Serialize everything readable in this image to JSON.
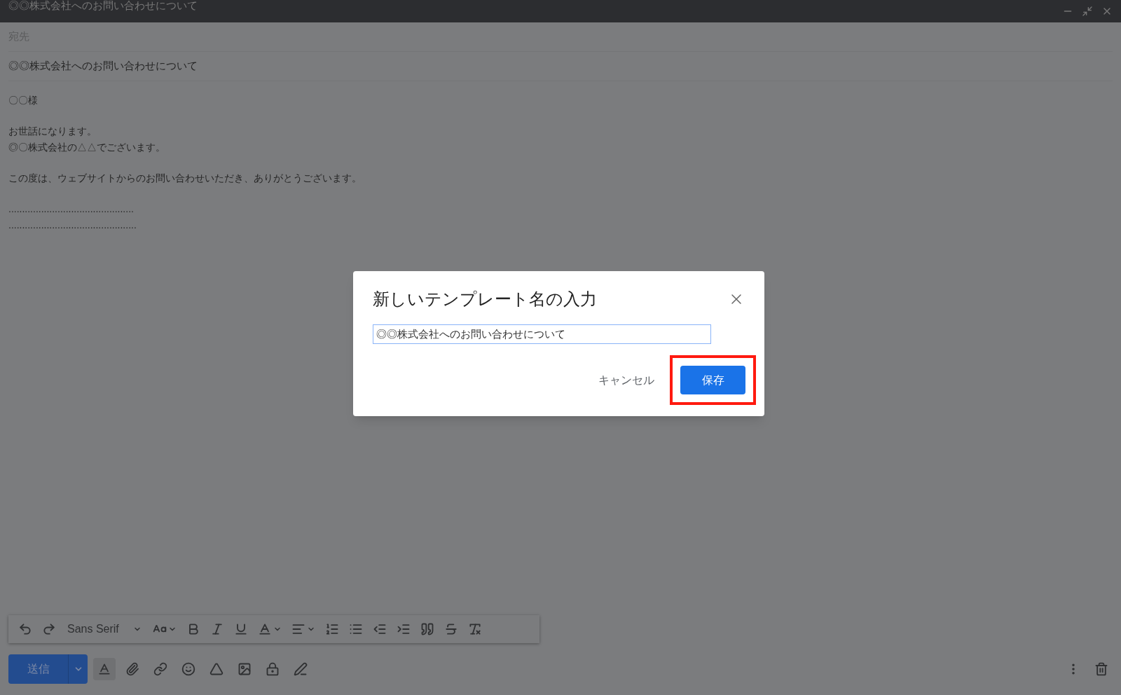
{
  "window": {
    "title": "◎◎株式会社へのお問い合わせについて"
  },
  "compose": {
    "to_placeholder": "宛先",
    "subject": "◎◎株式会社へのお問い合わせについて",
    "body": [
      {
        "lines": [
          "〇〇様"
        ]
      },
      {
        "lines": [
          "お世話になります。",
          "◎〇株式会社の△△でございます。"
        ]
      },
      {
        "lines": [
          "この度は、ウェブサイトからのお問い合わせいただき、ありがとうございます。"
        ]
      },
      {
        "lines": [
          "..............................................",
          "..............................................."
        ]
      }
    ]
  },
  "toolbar": {
    "font": "Sans Serif"
  },
  "send_button": "送信",
  "dialog": {
    "title": "新しいテンプレート名の入力",
    "value": "◎◎株式会社へのお問い合わせについて",
    "cancel": "キャンセル",
    "save": {
      "label": "保存",
      "highlighted": true
    }
  }
}
